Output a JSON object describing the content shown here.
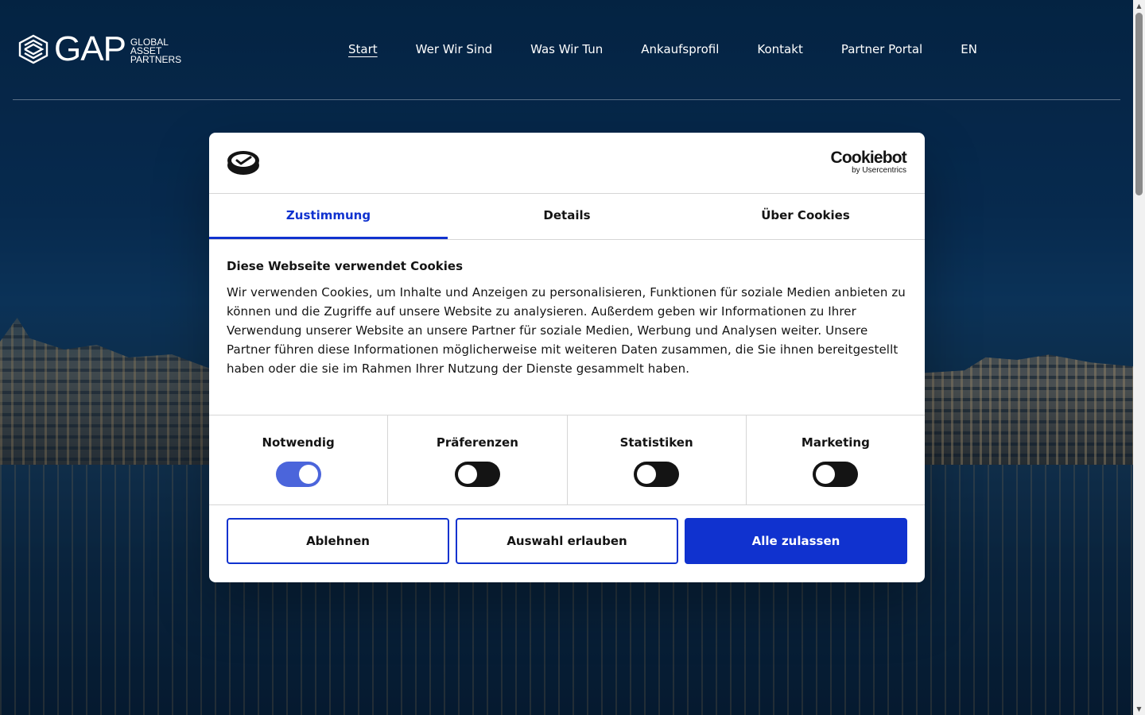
{
  "header": {
    "logo": {
      "wordmark": "GAP",
      "sub_lines": [
        "GLOBAL",
        "ASSET",
        "PARTNERS"
      ]
    },
    "nav": [
      {
        "label": "Start",
        "active": true
      },
      {
        "label": "Wer Wir Sind"
      },
      {
        "label": "Was Wir Tun"
      },
      {
        "label": "Ankaufsprofil"
      },
      {
        "label": "Kontakt"
      },
      {
        "label": "Partner Portal"
      },
      {
        "label": "EN"
      }
    ]
  },
  "dialog": {
    "brand": {
      "name": "Cookiebot",
      "by": "by Usercentrics"
    },
    "tabs": [
      {
        "label": "Zustimmung",
        "active": true
      },
      {
        "label": "Details"
      },
      {
        "label": "Über Cookies"
      }
    ],
    "title": "Diese Webseite verwendet Cookies",
    "text": "Wir verwenden Cookies, um Inhalte und Anzeigen zu personalisieren, Funktionen für soziale Medien anbieten zu können und die Zugriffe auf unsere Website zu analysieren. Außerdem geben wir Informationen zu Ihrer Verwendung unserer Website an unsere Partner für soziale Medien, Werbung und Analysen weiter. Unsere Partner führen diese Informationen möglicherweise mit weiteren Daten zusammen, die Sie ihnen bereitgestellt haben oder die sie im Rahmen Ihrer Nutzung der Dienste gesammelt haben.",
    "toggles": [
      {
        "label": "Notwendig",
        "on": true
      },
      {
        "label": "Präferenzen",
        "on": false
      },
      {
        "label": "Statistiken",
        "on": false
      },
      {
        "label": "Marketing",
        "on": false
      }
    ],
    "buttons": {
      "decline": "Ablehnen",
      "allow_selection": "Auswahl erlauben",
      "allow_all": "Alle zulassen"
    }
  },
  "colors": {
    "accent": "#1032cf",
    "background": "#062848"
  }
}
